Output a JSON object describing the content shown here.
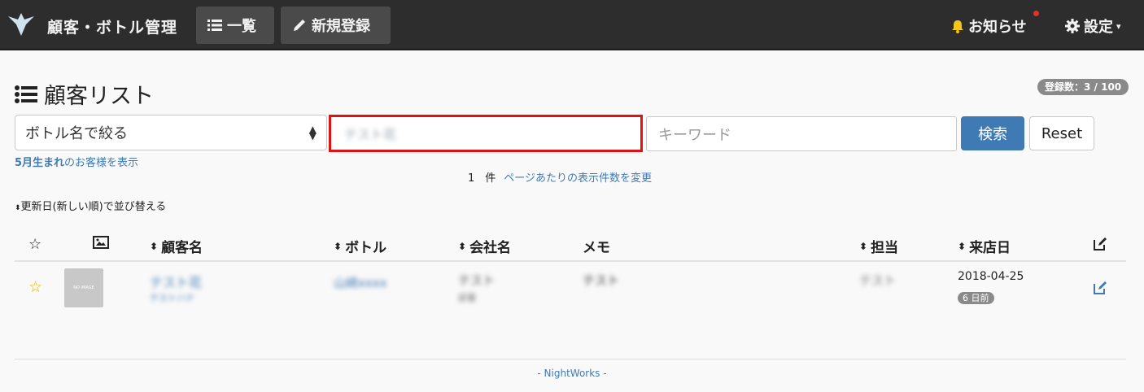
{
  "header": {
    "app_title": "顧客・ボトル管理",
    "nav": [
      {
        "label": "一覧",
        "icon": "list-icon"
      },
      {
        "label": "新規登録",
        "icon": "pencil-icon"
      }
    ],
    "notice_label": "お知らせ",
    "settings_label": "設定"
  },
  "page": {
    "title": "顧客リスト",
    "registration_badge": "登録数：3 / 100"
  },
  "filters": {
    "bottle_select": "ボトル名で絞る",
    "name_value": "テスト花",
    "keyword_placeholder": "キーワード",
    "search_label": "検索",
    "reset_label": "Reset",
    "birthday_bold": "5月生まれ",
    "birthday_rest": "のお客様を表示",
    "count": "1　件",
    "per_page_link": "ページあたりの表示件数を変更",
    "sort_label": "更新日(新しい順)で並び替える"
  },
  "table": {
    "columns": [
      "顧客名",
      "ボトル",
      "会社名",
      "メモ",
      "担当",
      "来店日"
    ],
    "rows": [
      {
        "name": "テスト花",
        "name_kana": "テストハナ",
        "bottle": "山崎xxxx",
        "company": "テスト",
        "company_sub": "部署",
        "memo": "テスト",
        "staff": "テスト",
        "visit_date": "2018-04-25",
        "days_ago": "6 日前",
        "image_text": "NO IMAGE"
      }
    ]
  },
  "footer": {
    "text": "- NightWorks -"
  }
}
